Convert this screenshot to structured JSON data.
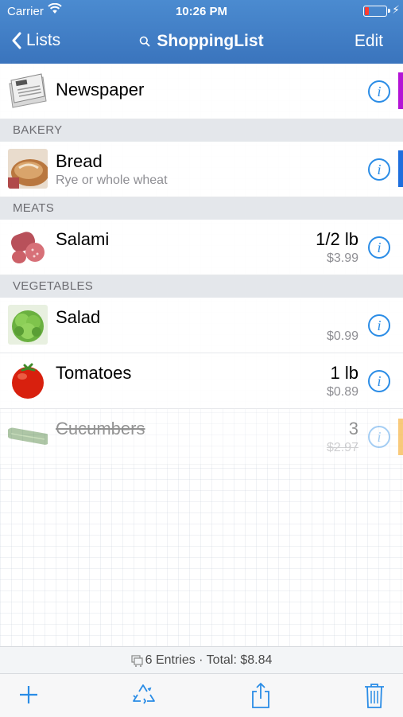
{
  "status": {
    "carrier": "Carrier",
    "time": "10:26 PM"
  },
  "nav": {
    "back_label": "Lists",
    "title": "ShoppingList",
    "edit_label": "Edit"
  },
  "items_top": [
    {
      "name": "Newspaper",
      "tag_color": "#b414d6"
    }
  ],
  "sections": [
    {
      "header": "BAKERY",
      "items": [
        {
          "name": "Bread",
          "note": "Rye or whole wheat",
          "tag_color": "#1f6fde"
        }
      ]
    },
    {
      "header": "MEATS",
      "items": [
        {
          "name": "Salami",
          "quantity": "1/2 lb",
          "price": "$3.99"
        }
      ]
    },
    {
      "header": "VEGETABLES",
      "items": [
        {
          "name": "Salad",
          "price": "$0.99"
        },
        {
          "name": "Tomatoes",
          "quantity": "1 lb",
          "price": "$0.89"
        },
        {
          "name": "Cucumbers",
          "quantity": "3",
          "price": "$2.97",
          "checked": true,
          "tag_color": "#f5a623"
        }
      ]
    }
  ],
  "footer": {
    "summary": "6 Entries · Total: $8.84"
  },
  "toolbar": {
    "icons": [
      "plus-icon",
      "recycle-icon",
      "share-icon",
      "trash-icon"
    ]
  },
  "colors": {
    "accent": "#2a8ce6",
    "header": "#3f7fc8"
  }
}
